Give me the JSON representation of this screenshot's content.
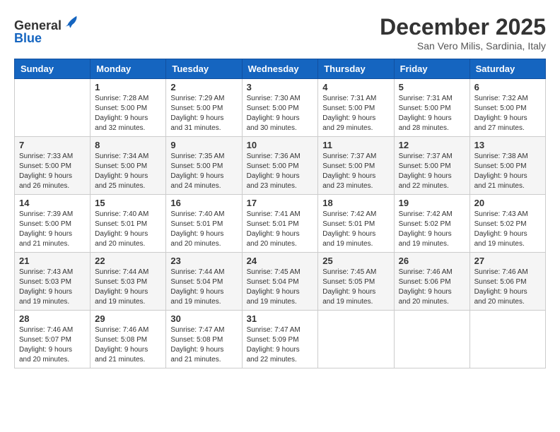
{
  "header": {
    "logo_line1": "General",
    "logo_line2": "Blue",
    "month": "December 2025",
    "location": "San Vero Milis, Sardinia, Italy"
  },
  "days_of_week": [
    "Sunday",
    "Monday",
    "Tuesday",
    "Wednesday",
    "Thursday",
    "Friday",
    "Saturday"
  ],
  "weeks": [
    [
      {
        "day": "",
        "info": ""
      },
      {
        "day": "1",
        "info": "Sunrise: 7:28 AM\nSunset: 5:00 PM\nDaylight: 9 hours\nand 32 minutes."
      },
      {
        "day": "2",
        "info": "Sunrise: 7:29 AM\nSunset: 5:00 PM\nDaylight: 9 hours\nand 31 minutes."
      },
      {
        "day": "3",
        "info": "Sunrise: 7:30 AM\nSunset: 5:00 PM\nDaylight: 9 hours\nand 30 minutes."
      },
      {
        "day": "4",
        "info": "Sunrise: 7:31 AM\nSunset: 5:00 PM\nDaylight: 9 hours\nand 29 minutes."
      },
      {
        "day": "5",
        "info": "Sunrise: 7:31 AM\nSunset: 5:00 PM\nDaylight: 9 hours\nand 28 minutes."
      },
      {
        "day": "6",
        "info": "Sunrise: 7:32 AM\nSunset: 5:00 PM\nDaylight: 9 hours\nand 27 minutes."
      }
    ],
    [
      {
        "day": "7",
        "info": "Sunrise: 7:33 AM\nSunset: 5:00 PM\nDaylight: 9 hours\nand 26 minutes."
      },
      {
        "day": "8",
        "info": "Sunrise: 7:34 AM\nSunset: 5:00 PM\nDaylight: 9 hours\nand 25 minutes."
      },
      {
        "day": "9",
        "info": "Sunrise: 7:35 AM\nSunset: 5:00 PM\nDaylight: 9 hours\nand 24 minutes."
      },
      {
        "day": "10",
        "info": "Sunrise: 7:36 AM\nSunset: 5:00 PM\nDaylight: 9 hours\nand 23 minutes."
      },
      {
        "day": "11",
        "info": "Sunrise: 7:37 AM\nSunset: 5:00 PM\nDaylight: 9 hours\nand 23 minutes."
      },
      {
        "day": "12",
        "info": "Sunrise: 7:37 AM\nSunset: 5:00 PM\nDaylight: 9 hours\nand 22 minutes."
      },
      {
        "day": "13",
        "info": "Sunrise: 7:38 AM\nSunset: 5:00 PM\nDaylight: 9 hours\nand 21 minutes."
      }
    ],
    [
      {
        "day": "14",
        "info": "Sunrise: 7:39 AM\nSunset: 5:00 PM\nDaylight: 9 hours\nand 21 minutes."
      },
      {
        "day": "15",
        "info": "Sunrise: 7:40 AM\nSunset: 5:01 PM\nDaylight: 9 hours\nand 20 minutes."
      },
      {
        "day": "16",
        "info": "Sunrise: 7:40 AM\nSunset: 5:01 PM\nDaylight: 9 hours\nand 20 minutes."
      },
      {
        "day": "17",
        "info": "Sunrise: 7:41 AM\nSunset: 5:01 PM\nDaylight: 9 hours\nand 20 minutes."
      },
      {
        "day": "18",
        "info": "Sunrise: 7:42 AM\nSunset: 5:01 PM\nDaylight: 9 hours\nand 19 minutes."
      },
      {
        "day": "19",
        "info": "Sunrise: 7:42 AM\nSunset: 5:02 PM\nDaylight: 9 hours\nand 19 minutes."
      },
      {
        "day": "20",
        "info": "Sunrise: 7:43 AM\nSunset: 5:02 PM\nDaylight: 9 hours\nand 19 minutes."
      }
    ],
    [
      {
        "day": "21",
        "info": "Sunrise: 7:43 AM\nSunset: 5:03 PM\nDaylight: 9 hours\nand 19 minutes."
      },
      {
        "day": "22",
        "info": "Sunrise: 7:44 AM\nSunset: 5:03 PM\nDaylight: 9 hours\nand 19 minutes."
      },
      {
        "day": "23",
        "info": "Sunrise: 7:44 AM\nSunset: 5:04 PM\nDaylight: 9 hours\nand 19 minutes."
      },
      {
        "day": "24",
        "info": "Sunrise: 7:45 AM\nSunset: 5:04 PM\nDaylight: 9 hours\nand 19 minutes."
      },
      {
        "day": "25",
        "info": "Sunrise: 7:45 AM\nSunset: 5:05 PM\nDaylight: 9 hours\nand 19 minutes."
      },
      {
        "day": "26",
        "info": "Sunrise: 7:46 AM\nSunset: 5:06 PM\nDaylight: 9 hours\nand 20 minutes."
      },
      {
        "day": "27",
        "info": "Sunrise: 7:46 AM\nSunset: 5:06 PM\nDaylight: 9 hours\nand 20 minutes."
      }
    ],
    [
      {
        "day": "28",
        "info": "Sunrise: 7:46 AM\nSunset: 5:07 PM\nDaylight: 9 hours\nand 20 minutes."
      },
      {
        "day": "29",
        "info": "Sunrise: 7:46 AM\nSunset: 5:08 PM\nDaylight: 9 hours\nand 21 minutes."
      },
      {
        "day": "30",
        "info": "Sunrise: 7:47 AM\nSunset: 5:08 PM\nDaylight: 9 hours\nand 21 minutes."
      },
      {
        "day": "31",
        "info": "Sunrise: 7:47 AM\nSunset: 5:09 PM\nDaylight: 9 hours\nand 22 minutes."
      },
      {
        "day": "",
        "info": ""
      },
      {
        "day": "",
        "info": ""
      },
      {
        "day": "",
        "info": ""
      }
    ]
  ]
}
